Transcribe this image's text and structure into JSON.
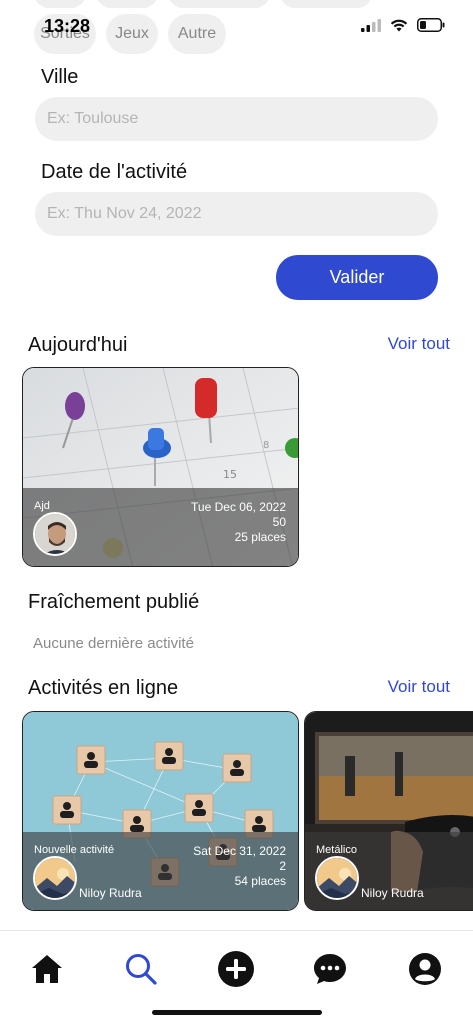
{
  "status_bar": {
    "time": "13:28"
  },
  "categories": {
    "chips": [
      {
        "label": "Sorties"
      },
      {
        "label": "Jeux"
      },
      {
        "label": "Autre"
      }
    ]
  },
  "form": {
    "city_label": "Ville",
    "city_placeholder": "Ex: Toulouse",
    "date_label": "Date de l'activité",
    "date_placeholder": "Ex: Thu Nov 24, 2022",
    "submit_label": "Valider"
  },
  "today": {
    "title": "Aujourd'hui",
    "see_all": "Voir tout",
    "cards": [
      {
        "author": "Ajd",
        "date": "Tue Dec 06, 2022",
        "count": "50",
        "places": "25 places",
        "user": ""
      }
    ]
  },
  "recent": {
    "title": "Fraîchement publié",
    "empty_text": "Aucune dernière activité"
  },
  "online": {
    "title": "Activités en ligne",
    "see_all": "Voir tout",
    "cards": [
      {
        "author": "Nouvelle activité",
        "date": "Sat Dec 31, 2022",
        "count": "2",
        "places": "54 places",
        "user": "Niloy Rudra"
      },
      {
        "author": "Metálico",
        "date": "",
        "count": "",
        "places": "",
        "user": "Niloy Rudra"
      }
    ]
  },
  "tabbar": {
    "items": [
      {
        "icon": "home-icon"
      },
      {
        "icon": "search-icon"
      },
      {
        "icon": "add-icon"
      },
      {
        "icon": "chat-icon"
      },
      {
        "icon": "profile-icon"
      }
    ]
  },
  "colors": {
    "accent": "#2f4ad1",
    "input_bg": "#efefef"
  }
}
